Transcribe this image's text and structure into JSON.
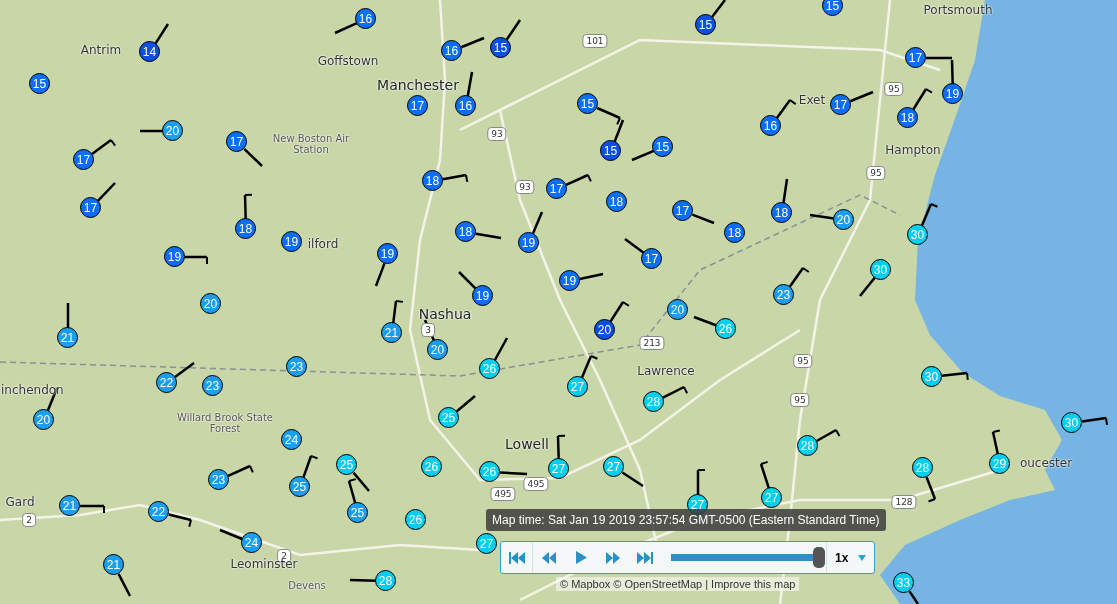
{
  "map": {
    "places": [
      {
        "name": "Portsmouth",
        "kind": "town"
      },
      {
        "name": "Antrim",
        "kind": "town"
      },
      {
        "name": "Goffstown",
        "kind": "town"
      },
      {
        "name": "Manchester",
        "kind": "city"
      },
      {
        "name": "Exet",
        "kind": "town"
      },
      {
        "name": "New Boston Air Station",
        "kind": "poi"
      },
      {
        "name": "Hampton",
        "kind": "town"
      },
      {
        "name": "ilford",
        "kind": "town"
      },
      {
        "name": "Nashua",
        "kind": "city"
      },
      {
        "name": "Lawrence",
        "kind": "town"
      },
      {
        "name": "inchendon",
        "kind": "town"
      },
      {
        "name": "Willard Brook State Forest",
        "kind": "poi"
      },
      {
        "name": "Lowell",
        "kind": "city"
      },
      {
        "name": "oucester",
        "kind": "town"
      },
      {
        "name": "Gard",
        "kind": "town"
      },
      {
        "name": "Leominster",
        "kind": "town"
      },
      {
        "name": "Devens",
        "kind": "poi"
      }
    ],
    "routes": [
      "101",
      "93",
      "93",
      "95",
      "95",
      "95",
      "95",
      "213",
      "3",
      "495",
      "495",
      "128",
      "2",
      "2"
    ],
    "stations": [
      {
        "value": "14",
        "color": "#0a4fe6"
      },
      {
        "value": "15",
        "color": "#0a6ef7"
      },
      {
        "value": "16",
        "color": "#0a6ef7"
      },
      {
        "value": "20",
        "color": "#1a9ff0"
      },
      {
        "value": "17",
        "color": "#0a6ef7"
      },
      {
        "value": "17",
        "color": "#0a6ef7"
      },
      {
        "value": "17",
        "color": "#0a6ef7"
      },
      {
        "value": "18",
        "color": "#0a6ef7"
      },
      {
        "value": "19",
        "color": "#0a6ef7"
      },
      {
        "value": "19",
        "color": "#0a6ef7"
      },
      {
        "value": "16",
        "color": "#0a6ef7"
      },
      {
        "value": "15",
        "color": "#0a4fe6"
      },
      {
        "value": "17",
        "color": "#0a6ef7"
      },
      {
        "value": "16",
        "color": "#0a6ef7"
      },
      {
        "value": "15",
        "color": "#0a4fe6"
      },
      {
        "value": "18",
        "color": "#0a6ef7"
      },
      {
        "value": "15",
        "color": "#0a6ef7"
      },
      {
        "value": "15",
        "color": "#0a4fe6"
      },
      {
        "value": "15",
        "color": "#0a6ef7"
      },
      {
        "value": "17",
        "color": "#0a6ef7"
      },
      {
        "value": "18",
        "color": "#0a6ef7"
      },
      {
        "value": "17",
        "color": "#0a6ef7"
      },
      {
        "value": "18",
        "color": "#0a6ef7"
      },
      {
        "value": "18",
        "color": "#0a6ef7"
      },
      {
        "value": "19",
        "color": "#0a6ef7"
      },
      {
        "value": "19",
        "color": "#0a6ef7"
      },
      {
        "value": "19",
        "color": "#0a6ef7"
      },
      {
        "value": "19",
        "color": "#0a6ef7"
      },
      {
        "value": "17",
        "color": "#0a6ef7"
      },
      {
        "value": "15",
        "color": "#0a6ef7"
      },
      {
        "value": "17",
        "color": "#0a6ef7"
      },
      {
        "value": "19",
        "color": "#0a6ef7"
      },
      {
        "value": "17",
        "color": "#0a6ef7"
      },
      {
        "value": "18",
        "color": "#0a6ef7"
      },
      {
        "value": "16",
        "color": "#0a6ef7"
      },
      {
        "value": "18",
        "color": "#0a6ef7"
      },
      {
        "value": "20",
        "color": "#1a9ff0"
      },
      {
        "value": "30",
        "color": "#00cff0"
      },
      {
        "value": "30",
        "color": "#00cff0"
      },
      {
        "value": "23",
        "color": "#1a9ff0"
      },
      {
        "value": "20",
        "color": "#1a9ff0"
      },
      {
        "value": "20",
        "color": "#0a4fe6"
      },
      {
        "value": "26",
        "color": "#00cff0"
      },
      {
        "value": "27",
        "color": "#00cff0"
      },
      {
        "value": "21",
        "color": "#1a9ff0"
      },
      {
        "value": "20",
        "color": "#1a9ff0"
      },
      {
        "value": "26",
        "color": "#00cff0"
      },
      {
        "value": "21",
        "color": "#1a9ff0"
      },
      {
        "value": "22",
        "color": "#1a9ff0"
      },
      {
        "value": "23",
        "color": "#1a9ff0"
      },
      {
        "value": "23",
        "color": "#1a9ff0"
      },
      {
        "value": "20",
        "color": "#1a9ff0"
      },
      {
        "value": "20",
        "color": "#1a9ff0"
      },
      {
        "value": "25",
        "color": "#00cff0"
      },
      {
        "value": "28",
        "color": "#00cff0"
      },
      {
        "value": "28",
        "color": "#00cff0"
      },
      {
        "value": "30",
        "color": "#00cff0"
      },
      {
        "value": "30",
        "color": "#00cff0"
      },
      {
        "value": "29",
        "color": "#00cff0"
      },
      {
        "value": "28",
        "color": "#00cff0"
      },
      {
        "value": "24",
        "color": "#1a9ff0"
      },
      {
        "value": "25",
        "color": "#00cff0"
      },
      {
        "value": "25",
        "color": "#1a9ff0"
      },
      {
        "value": "25",
        "color": "#1a9ff0"
      },
      {
        "value": "26",
        "color": "#00cff0"
      },
      {
        "value": "26",
        "color": "#00cff0"
      },
      {
        "value": "27",
        "color": "#00cff0"
      },
      {
        "value": "27",
        "color": "#00cff0"
      },
      {
        "value": "23",
        "color": "#1a9ff0"
      },
      {
        "value": "21",
        "color": "#1a9ff0"
      },
      {
        "value": "22",
        "color": "#1a9ff0"
      },
      {
        "value": "24",
        "color": "#1a9ff0"
      },
      {
        "value": "21",
        "color": "#1a9ff0"
      },
      {
        "value": "26",
        "color": "#00cff0"
      },
      {
        "value": "27",
        "color": "#00cff0"
      },
      {
        "value": "27",
        "color": "#00cff0"
      },
      {
        "value": "28",
        "color": "#00cff0"
      },
      {
        "value": "33",
        "color": "#00cff0"
      },
      {
        "value": "27",
        "color": "#00cff0"
      }
    ]
  },
  "timeline": {
    "map_time": "Map time: Sat Jan 19 2019 23:57:54 GMT-0500 (Eastern Standard Time)",
    "slider": {
      "level": 1
    },
    "speed": "1x"
  },
  "attribution": {
    "text": "© Mapbox © OpenStreetMap |",
    "link": "Improve this map"
  }
}
